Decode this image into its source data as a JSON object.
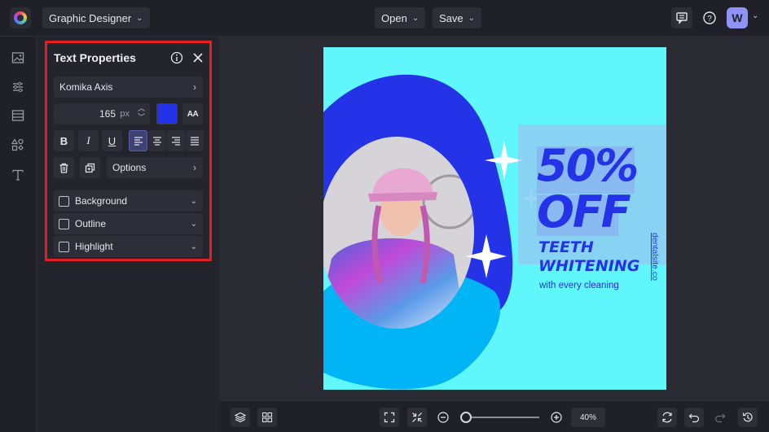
{
  "header": {
    "project_menu_label": "Graphic Designer",
    "open_label": "Open",
    "save_label": "Save",
    "avatar_letter": "W"
  },
  "panel": {
    "title": "Text Properties",
    "font_name": "Komika Axis",
    "font_size": "165",
    "font_size_unit": "px",
    "text_color": "#2432e8",
    "options_label": "Options",
    "sections": [
      {
        "label": "Background",
        "checked": false
      },
      {
        "label": "Outline",
        "checked": false
      },
      {
        "label": "Highlight",
        "checked": false
      }
    ],
    "bold_glyph": "B",
    "italic_glyph": "I",
    "underline_glyph": "U",
    "text_case_glyph": "AA"
  },
  "design": {
    "headline_line1": "50%",
    "headline_line2": "OFF",
    "subhead_line1": "TEETH",
    "subhead_line2": "WHITENING",
    "tagline": "with every cleaning",
    "website": "dentalsite.co",
    "background_color": "#5ff7fb",
    "accent_blue": "#2432e8",
    "accent_sky": "#00b4f5"
  },
  "footer": {
    "zoom_level": "40%"
  }
}
